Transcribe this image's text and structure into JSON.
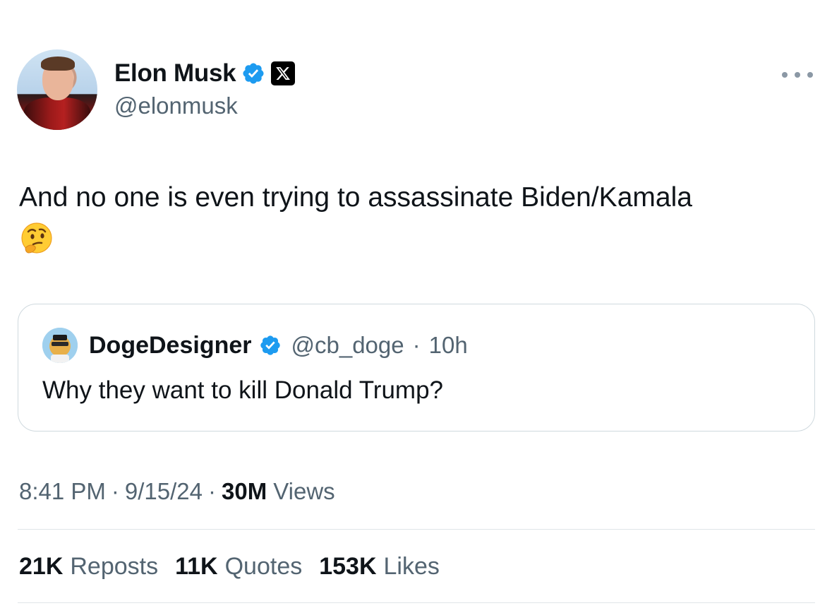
{
  "author": {
    "display_name": "Elon Musk",
    "handle": "@elonmusk",
    "verified_icon": "verified-badge-icon",
    "affiliation_icon": "x-logo-icon"
  },
  "tweet": {
    "text": "And no one is even trying to assassinate Biden/Kamala",
    "emoji": "🤔"
  },
  "quoted": {
    "display_name": "DogeDesigner",
    "handle": "@cb_doge",
    "separator": "·",
    "time": "10h",
    "text": "Why they want to kill Donald Trump?"
  },
  "meta": {
    "time": "8:41 PM",
    "date": "9/15/24",
    "separator": "·",
    "views_count": "30M",
    "views_label": "Views"
  },
  "stats": [
    {
      "count": "21K",
      "label": "Reposts"
    },
    {
      "count": "11K",
      "label": "Quotes"
    },
    {
      "count": "153K",
      "label": "Likes"
    }
  ],
  "colors": {
    "verified_blue": "#1d9bf0",
    "text_primary": "#0f1419",
    "text_secondary": "#536471",
    "border": "#cfd9de"
  }
}
